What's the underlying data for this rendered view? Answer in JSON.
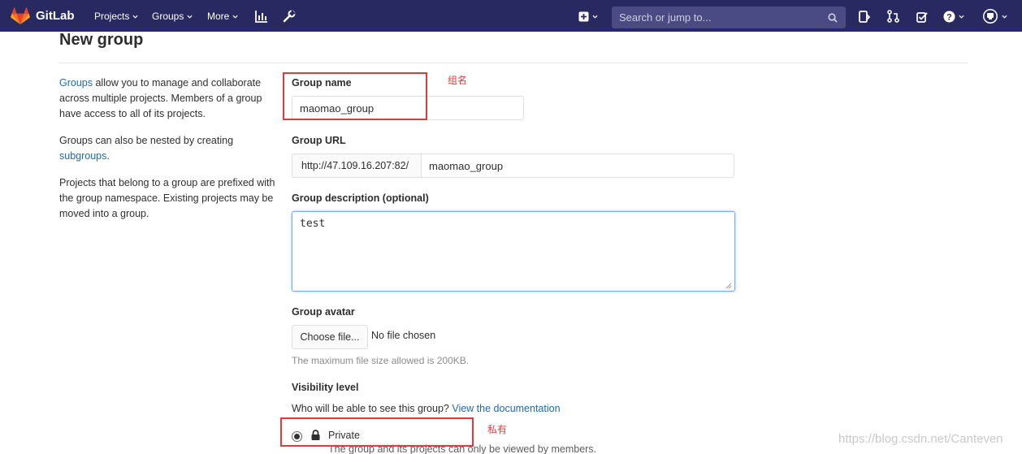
{
  "navbar": {
    "brand": "GitLab",
    "projects": "Projects",
    "groups": "Groups",
    "more": "More",
    "search_placeholder": "Search or jump to..."
  },
  "page": {
    "title": "New group"
  },
  "sidebar": {
    "p1_link": "Groups",
    "p1_text": " allow you to manage and collaborate across multiple projects. Members of a group have access to all of its projects.",
    "p2_text": "Groups can also be nested by creating ",
    "p2_link": "subgroups",
    "p2_end": ".",
    "p3_text": "Projects that belong to a group are prefixed with the group namespace. Existing projects may be moved into a group."
  },
  "form": {
    "group_name_label": "Group name",
    "group_name_value": "maomao_group",
    "group_url_label": "Group URL",
    "group_url_prefix": "http://47.109.16.207:82/",
    "group_url_value": "maomao_group",
    "description_label": "Group description (optional)",
    "description_value": "test",
    "avatar_label": "Group avatar",
    "choose_file": "Choose file...",
    "no_file": "No file chosen",
    "max_size": "The maximum file size allowed is 200KB.",
    "visibility_label": "Visibility level",
    "visibility_question": "Who will be able to see this group? ",
    "visibility_link": "View the documentation",
    "private_label": "Private",
    "private_desc": "The group and its projects can only be viewed by members."
  },
  "annotations": {
    "name_note": "组名",
    "private_note": "私有"
  },
  "watermark": "https://blog.csdn.net/Canteven",
  "colors": {
    "navbar_bg": "#292961",
    "link": "#1b69b6",
    "annotation": "#e23a3a"
  }
}
